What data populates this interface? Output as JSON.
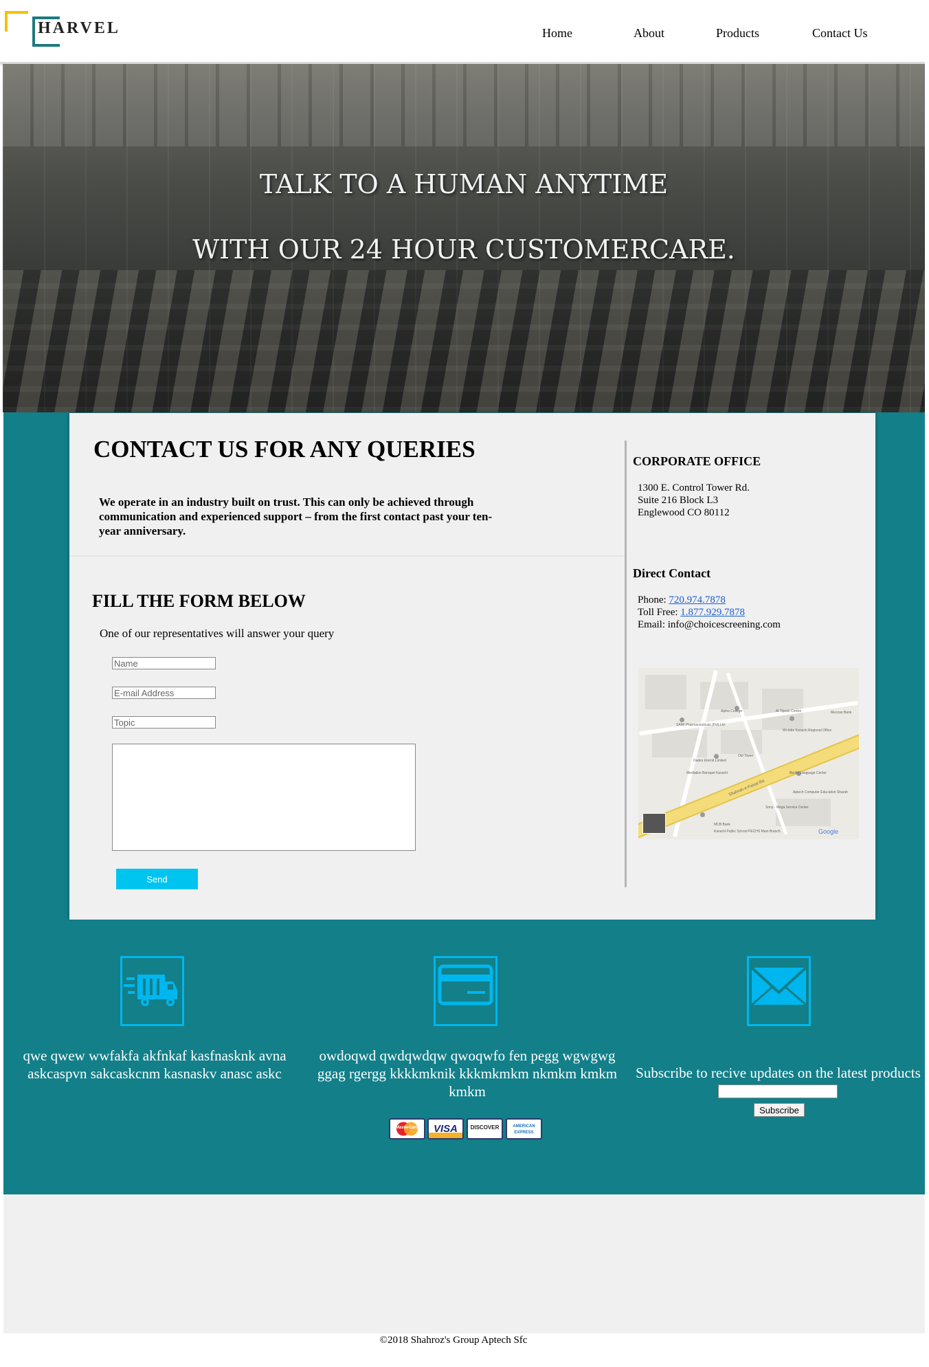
{
  "logo": {
    "text": "HARVEL"
  },
  "nav": {
    "items": [
      "Home",
      "About",
      "Products",
      "Contact Us"
    ]
  },
  "hero": {
    "line1": "TALK TO A HUMAN ANYTIME",
    "line2": "WITH OUR 24 HOUR CUSTOMERCARE."
  },
  "contact": {
    "heading": "CONTACT US FOR ANY QUERIES",
    "intro": "We operate in an industry built on trust. This can only be achieved through communication and experienced support – from the first contact past your ten-year anniversary.",
    "form_heading": "FILL THE FORM BELOW",
    "form_sub": "One of our representatives will answer your query",
    "placeholders": {
      "name": "Name",
      "email": "E-mail Address",
      "topic": "Topic"
    },
    "send_label": "Send"
  },
  "office": {
    "heading": "CORPORATE OFFICE",
    "address1": "1300 E. Control Tower Rd.",
    "address2": "Suite 216 Block L3",
    "address3": "Englewood CO 80112",
    "direct_heading": "Direct Contact",
    "phone_label": "Phone: ",
    "phone": "720.974.7878",
    "tollfree_label": "Toll Free: ",
    "tollfree": "1.877.929.7878",
    "email_line": "Email: info@choicescreening.com",
    "map_labels": [
      "Alpha College",
      "Al Tijarah Centre",
      "Mezzan Bank",
      "SAMI Pharmaceuticals (Pvt) Ltd",
      "Wi-tribe Karachi Regional Office",
      "Dadex Eternit Limited",
      "Old Tower",
      "Mediation Banquet Karachi",
      "Berlitz Language Center",
      "Shahrah-e-Faisal Rd",
      "Aptech Computer Education Sharah",
      "Sony - Mega Service Center",
      "MCB Bank",
      "Karachi Public School PECHS Main Branch",
      "Google"
    ]
  },
  "footer": {
    "col1_text": "qwe qwew wwfakfa akfnkaf kasfnasknk avna askcaspvn sakcaskcnm kasnaskv anasc askc",
    "col2_text": "owdoqwd qwdqwdqw qwoqwfo fen pegg wgwgwg ggag rgergg kkkkmknik kkkmkmkm nkmkm kmkm kmkm",
    "col3_text": "Subscribe to recive updates on the latest products",
    "subscribe_label": "Subscribe",
    "payment_cards": [
      "MasterCard",
      "VISA",
      "DISCOVER",
      "AMERICAN EXPRESS"
    ],
    "icons": [
      "delivery-truck-icon",
      "credit-card-icon",
      "envelope-icon"
    ],
    "copyright": "©2018 Shahroz's Group Aptech Sfc"
  },
  "colors": {
    "teal": "#127f89",
    "accent_blue": "#00c4f0",
    "logo_yellow": "#f2c200"
  }
}
